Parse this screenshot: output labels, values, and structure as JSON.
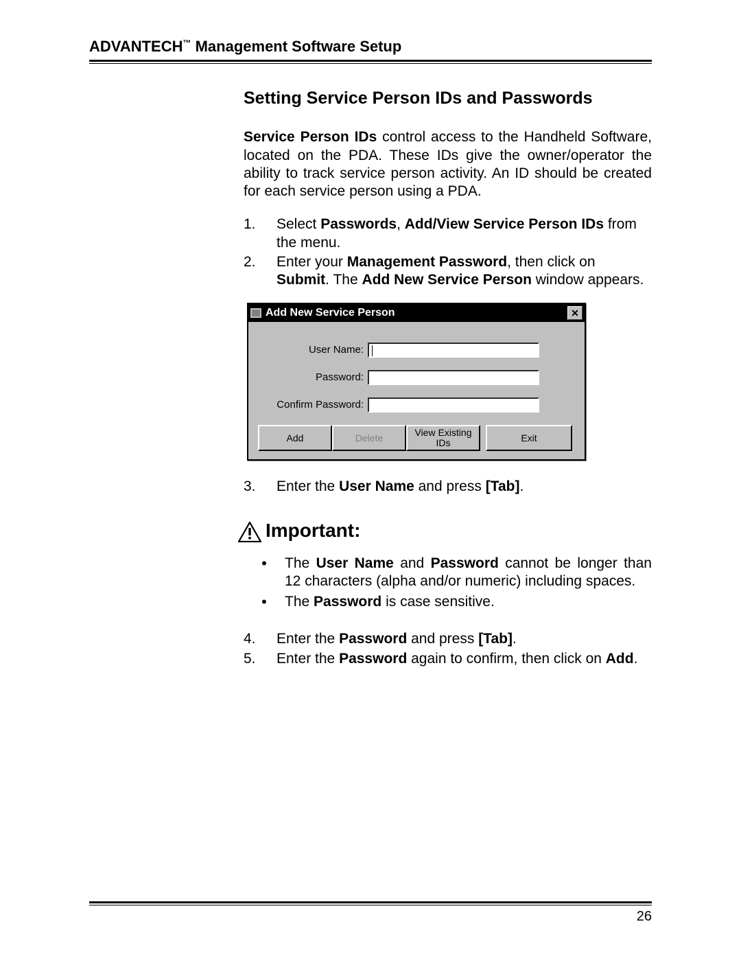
{
  "header": {
    "brand": "ADVANTECH",
    "tm": "™",
    "suffix": " Management Software Setup"
  },
  "section_title": "Setting Service Person IDs and Passwords",
  "intro": {
    "bold_lead": "Service Person IDs",
    "rest": " control access to the Handheld Software, located on the PDA. These IDs give the owner/operator the ability to track service person activity. An ID should be created for each service person using a PDA."
  },
  "steps_a": [
    {
      "n": "1.",
      "pre": "Select ",
      "b1": "Passwords",
      "mid": ", ",
      "b2": "Add/View Service Person IDs",
      "post": " from the menu."
    },
    {
      "n": "2.",
      "pre": "Enter your ",
      "b1": "Management Password",
      "mid": ", then click on ",
      "b2": "Submit",
      "mid2": ". The ",
      "b3": "Add New Service Person",
      "post": " window appears."
    }
  ],
  "dialog": {
    "title": "Add New Service Person",
    "labels": {
      "user": "User Name:",
      "pass": "Password:",
      "confirm": "Confirm Password:"
    },
    "buttons": {
      "add": "Add",
      "delete": "Delete",
      "view": "View Existing IDs",
      "exit": "Exit"
    }
  },
  "step3": {
    "n": "3.",
    "pre": "Enter the ",
    "b1": "User Name",
    "mid": " and press ",
    "b2": "[Tab]",
    "post": "."
  },
  "important_label": "Important:",
  "bullets": [
    {
      "pre": "The ",
      "b1": "User Name",
      "mid": " and ",
      "b2": "Password",
      "post": " cannot be longer than 12 characters (alpha and/or numeric) including spaces."
    },
    {
      "pre": "The ",
      "b1": "Password",
      "post": " is case sensitive."
    }
  ],
  "steps_b": [
    {
      "n": "4.",
      "pre": "Enter the ",
      "b1": "Password",
      "mid": " and press ",
      "b2": "[Tab]",
      "post": "."
    },
    {
      "n": "5.",
      "pre": "Enter the ",
      "b1": "Password",
      "mid": " again to confirm, then click on ",
      "b2": "Add",
      "post": "."
    }
  ],
  "page_number": "26"
}
